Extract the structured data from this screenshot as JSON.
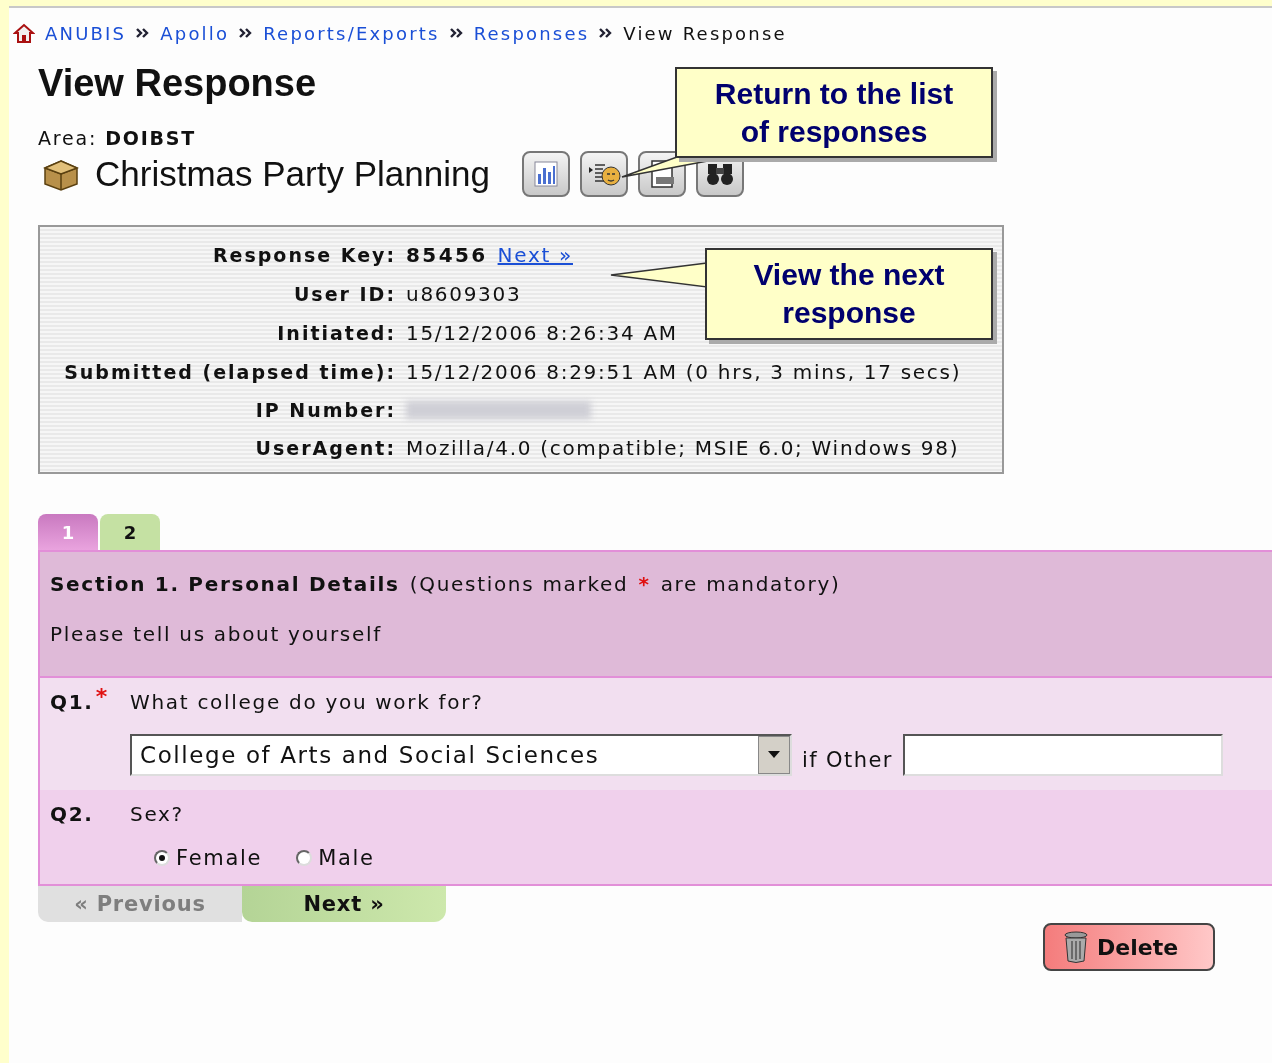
{
  "breadcrumb": [
    {
      "label": "ANUBIS",
      "link": true
    },
    {
      "label": "Apollo",
      "link": true
    },
    {
      "label": "Reports/Exports",
      "link": true
    },
    {
      "label": "Responses",
      "link": true
    },
    {
      "label": "View Response",
      "link": false
    }
  ],
  "page_title": "View Response",
  "area": {
    "label": "Area:",
    "value": "DOIBST"
  },
  "survey_title": "Christmas Party Planning",
  "details": [
    {
      "kind": "key",
      "label": "Response Key:",
      "value": "85456",
      "link": "Next »"
    },
    {
      "kind": "text",
      "label": "User ID:",
      "value": "u8609303"
    },
    {
      "kind": "text",
      "label": "Initiated:",
      "value": "15/12/2006 8:26:34 AM"
    },
    {
      "kind": "text",
      "label": "Submitted (elapsed time):",
      "value": "15/12/2006 8:29:51 AM (0 hrs, 3 mins, 17 secs)"
    },
    {
      "kind": "redacted",
      "label": "IP Number:"
    },
    {
      "kind": "text",
      "label": "UserAgent:",
      "value": "Mozilla/4.0 (compatible; MSIE 6.0; Windows 98)"
    }
  ],
  "tabs": [
    {
      "label": "1",
      "selected": true
    },
    {
      "label": "2",
      "selected": false
    }
  ],
  "section": {
    "title": "Section 1. Personal Details",
    "note_before": "(Questions marked",
    "mark": "*",
    "note_after": "are mandatory)",
    "intro": "Please tell us about yourself"
  },
  "questions": [
    {
      "kind": "select",
      "number": "Q1.",
      "mark": "*",
      "text": "What college do you work for?",
      "value": "College of Arts and Social Sciences",
      "other_label": "if Other"
    },
    {
      "kind": "radio",
      "number": "Q2.",
      "text": "Sex?",
      "options": [
        {
          "label": "Female",
          "selected": true
        },
        {
          "label": "Male",
          "selected": false
        }
      ]
    }
  ],
  "nav": [
    {
      "label": "« Previous",
      "disabled": true
    },
    {
      "label": "Next »",
      "disabled": false
    }
  ],
  "delete_button": "Delete",
  "callouts": [
    {
      "text": "Return to the list of responses"
    },
    {
      "text": "View the next response"
    }
  ]
}
